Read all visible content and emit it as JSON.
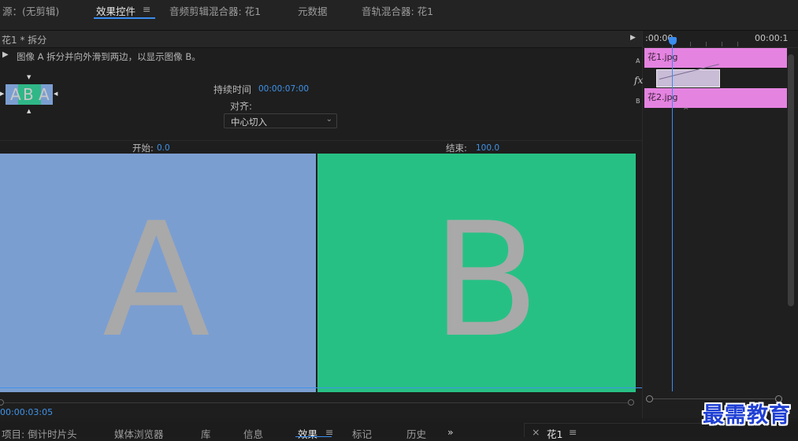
{
  "top_tabs": [
    {
      "label": "源：(无剪辑)"
    },
    {
      "label": "效果控件"
    },
    {
      "label": "≡"
    },
    {
      "label": "音频剪辑混合器: 花1"
    },
    {
      "label": "元数据"
    },
    {
      "label": "音轨混合器: 花1"
    }
  ],
  "effect_controls": {
    "header_title": "花1 * 拆分",
    "description": "图像 A 拆分并向外滑到两边，以显示图像 B。",
    "thumb_letters": {
      "a": "A",
      "b": "B"
    },
    "duration_label": "持续时间",
    "duration_value": "00:00:07:00",
    "align_label": "对齐:",
    "align_value": "中心切入",
    "start_label": "开始:",
    "start_value": "0.0",
    "end_label": "结束:",
    "end_value": "100.0",
    "preview_a_letter": "A",
    "preview_b_letter": "B",
    "timecode": "00:00:03:05"
  },
  "mini_timeline": {
    "ruler_start": ":00:00",
    "ruler_end": "00:00:1",
    "track_a_label": "A",
    "track_b_label": "B",
    "fx_label": "fx",
    "clip_a": "花1.jpg",
    "clip_b": "花2.jpg"
  },
  "bottom_tabs": [
    {
      "label": "项目: 倒计时片头"
    },
    {
      "label": "媒体浏览器"
    },
    {
      "label": "库"
    },
    {
      "label": "信息"
    },
    {
      "label": "效果"
    },
    {
      "label": "≡"
    },
    {
      "label": "标记"
    },
    {
      "label": "历史"
    },
    {
      "label": "»"
    },
    {
      "label": "×"
    },
    {
      "label": "花1"
    },
    {
      "label": "≡"
    }
  ],
  "watermark": "最需教育",
  "colors": {
    "accent_blue": "#3a8cf0",
    "clip_pink": "#e583e0",
    "preview_a_bg": "#7b9ed1",
    "preview_b_bg": "#27c084"
  }
}
